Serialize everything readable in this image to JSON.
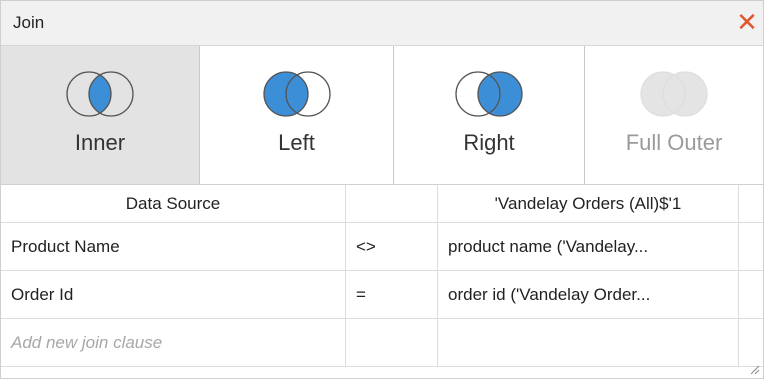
{
  "window": {
    "title": "Join"
  },
  "join_types": [
    {
      "label": "Inner",
      "selected": true,
      "enabled": true,
      "icon": "inner-join-icon"
    },
    {
      "label": "Left",
      "selected": false,
      "enabled": true,
      "icon": "left-join-icon"
    },
    {
      "label": "Right",
      "selected": false,
      "enabled": true,
      "icon": "right-join-icon"
    },
    {
      "label": "Full Outer",
      "selected": false,
      "enabled": false,
      "icon": "full-outer-join-icon"
    }
  ],
  "colors": {
    "accent": "#3c8fd6",
    "close": "#e0572f",
    "selected_bg": "#e3e3e3"
  },
  "clauses": {
    "headers": {
      "left": "Data Source",
      "right": "'Vandelay Orders (All)$'1"
    },
    "rows": [
      {
        "left": "Product Name",
        "operator": "<>",
        "right": "product name ('Vandelay..."
      },
      {
        "left": "Order Id",
        "operator": "=",
        "right": "order id ('Vandelay Order..."
      }
    ],
    "add_placeholder": "Add new join clause"
  }
}
